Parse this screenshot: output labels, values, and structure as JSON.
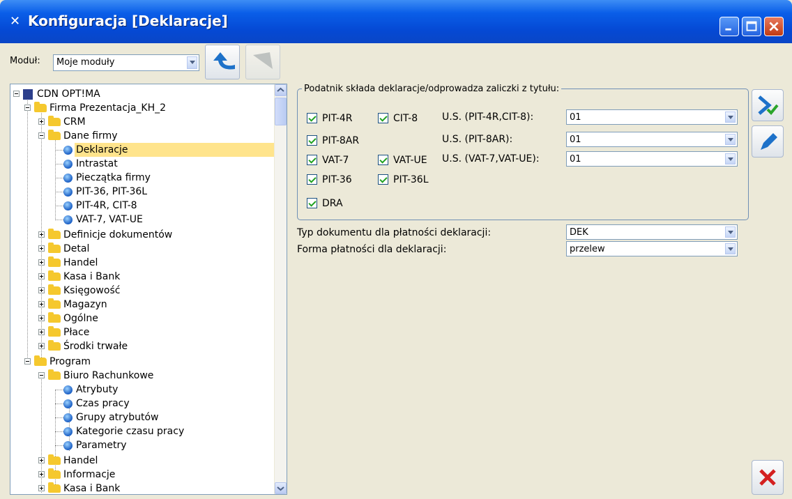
{
  "window": {
    "title": "Konfiguracja [Deklaracje]"
  },
  "module": {
    "label": "Moduł:",
    "value": "Moje moduły"
  },
  "tree": {
    "rows": [
      {
        "label": "CDN OPT!MA"
      },
      {
        "label": "Firma Prezentacja_KH_2"
      },
      {
        "label": "CRM"
      },
      {
        "label": "Dane firmy"
      },
      {
        "label": "Deklaracje"
      },
      {
        "label": "Intrastat"
      },
      {
        "label": "Pieczątka firmy"
      },
      {
        "label": "PIT-36, PIT-36L"
      },
      {
        "label": "PIT-4R, CIT-8"
      },
      {
        "label": "VAT-7, VAT-UE"
      },
      {
        "label": "Definicje dokumentów"
      },
      {
        "label": "Detal"
      },
      {
        "label": "Handel"
      },
      {
        "label": "Kasa i Bank"
      },
      {
        "label": "Księgowość"
      },
      {
        "label": "Magazyn"
      },
      {
        "label": "Ogólne"
      },
      {
        "label": "Płace"
      },
      {
        "label": "Środki trwałe"
      },
      {
        "label": "Program"
      },
      {
        "label": "Biuro Rachunkowe"
      },
      {
        "label": "Atrybuty"
      },
      {
        "label": "Czas pracy"
      },
      {
        "label": "Grupy atrybutów"
      },
      {
        "label": "Kategorie czasu pracy"
      },
      {
        "label": "Parametry"
      },
      {
        "label": "Handel"
      },
      {
        "label": "Informacje"
      },
      {
        "label": "Kasa i Bank"
      }
    ]
  },
  "group": {
    "legend": "Podatnik składa deklaracje/odprowadza zaliczki z tytułu:",
    "checkboxes": {
      "pit4r": "PIT-4R",
      "cit8": "CIT-8",
      "pit8ar": "PIT-8AR",
      "vat7": "VAT-7",
      "vatue": "VAT-UE",
      "pit36": "PIT-36",
      "pit36l": "PIT-36L",
      "dra": "DRA"
    },
    "us_fields": [
      {
        "label": "U.S. (PIT-4R,CIT-8):",
        "value": "01"
      },
      {
        "label": "U.S. (PIT-8AR):",
        "value": "01"
      },
      {
        "label": "U.S. (VAT-7,VAT-UE):",
        "value": "01"
      }
    ]
  },
  "doc_type": {
    "label": "Typ dokumentu dla płatności deklaracji:",
    "value": "DEK"
  },
  "payment": {
    "label": "Forma płatności dla deklaracji:",
    "value": "przelew"
  }
}
